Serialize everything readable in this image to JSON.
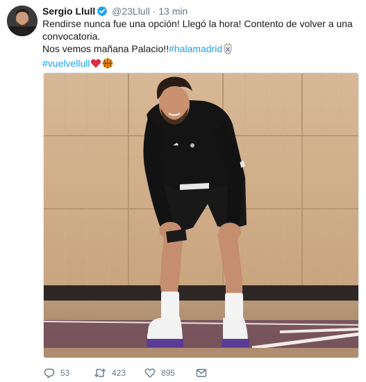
{
  "tweet": {
    "author": {
      "display_name": "Sergio Llull",
      "handle": "@23Llull",
      "verified": true
    },
    "separator": "·",
    "timestamp": "13 min",
    "text": {
      "line1": "Rendirse nunca fue una opción! Llegó la hora! Contento de volver a una",
      "line2": "convocatoria.",
      "line3_prefix": "Nos vemos mañana Palacio!!",
      "hashtag1": "#halamadrid",
      "hashtag2": "#vuelvellull"
    },
    "media": {
      "description_icon": "photo-player-on-court"
    },
    "actions": {
      "reply_count": "53",
      "retweet_count": "423",
      "like_count": "895"
    }
  },
  "colors": {
    "link": "#1da1f2",
    "secondary_text": "#657786",
    "verified_badge": "#1da1f2"
  },
  "icons": {
    "reply": "reply-icon",
    "retweet": "retweet-icon",
    "like": "heart-icon",
    "dm": "envelope-icon",
    "verified": "verified-badge-icon",
    "emoji1": "real-madrid-crest-emoji",
    "emoji2": "red-heart-emoji",
    "emoji3": "basketball-emoji"
  }
}
